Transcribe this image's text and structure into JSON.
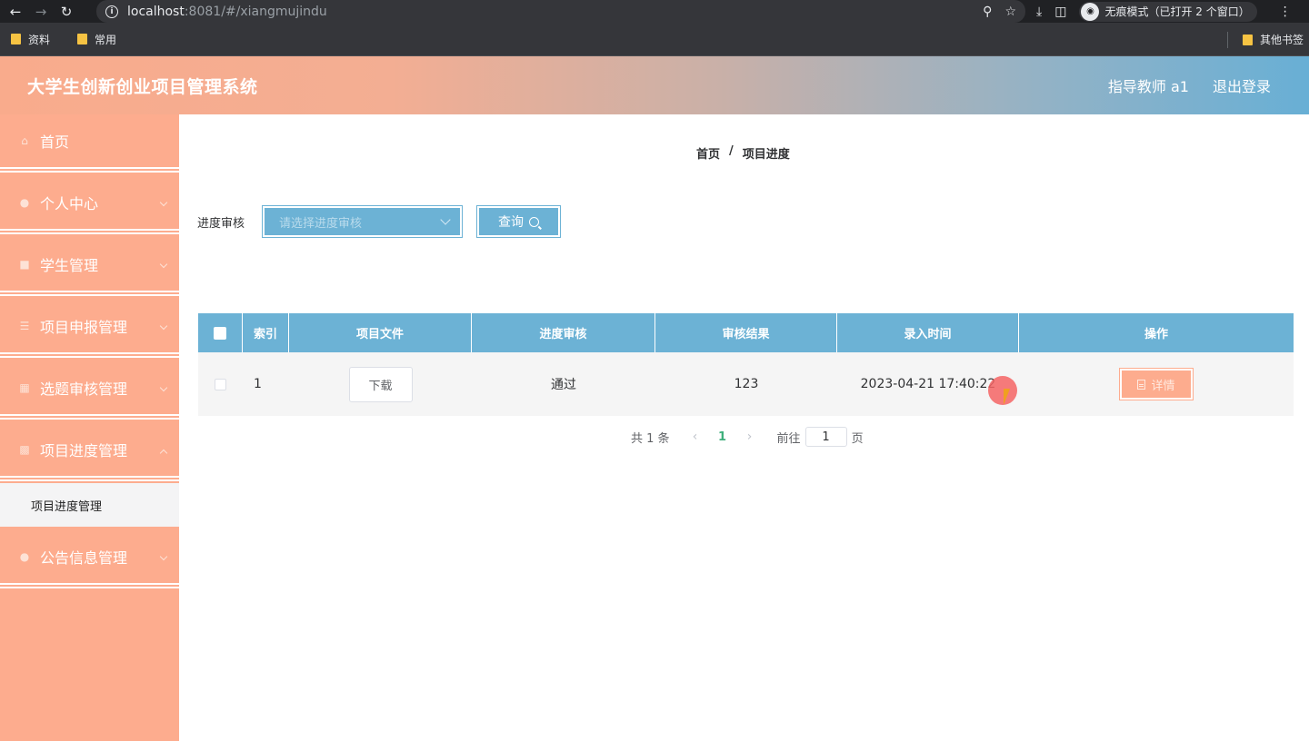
{
  "browser": {
    "url_host": "localhost",
    "url_rest": ":8081/#/xiangmujindu",
    "incognito_label": "无痕模式（已打开 2 个窗口）",
    "bookmarks": [
      "资料",
      "常用"
    ],
    "other_bookmarks": "其他书签"
  },
  "header": {
    "title": "大学生创新创业项目管理系统",
    "user": "指导教师 a1",
    "logout": "退出登录"
  },
  "sidebar": {
    "items": [
      {
        "label": "首页"
      },
      {
        "label": "个人中心"
      },
      {
        "label": "学生管理"
      },
      {
        "label": "项目申报管理"
      },
      {
        "label": "选题审核管理"
      },
      {
        "label": "项目进度管理"
      },
      {
        "label": "公告信息管理"
      }
    ],
    "submenu_label": "项目进度管理"
  },
  "breadcrumb": {
    "home": "首页",
    "separator": "/",
    "current": "项目进度"
  },
  "filter": {
    "label": "进度审核",
    "placeholder": "请选择进度审核",
    "query_label": "查询"
  },
  "table": {
    "headers": [
      "索引",
      "项目文件",
      "进度审核",
      "审核结果",
      "录入时间",
      "操作"
    ],
    "rows": [
      {
        "index": "1",
        "file_button": "下载",
        "review": "通过",
        "result": "123",
        "time": "2023-04-21 17:40:22",
        "action": "详情"
      }
    ]
  },
  "pagination": {
    "total": "共 1 条",
    "current_page": "1",
    "goto_prefix": "前往",
    "goto_value": "1",
    "goto_suffix": "页"
  },
  "colors": {
    "primary": "#6cb2d5",
    "accent": "#fdac8e",
    "active_page": "#3eaf7c"
  }
}
